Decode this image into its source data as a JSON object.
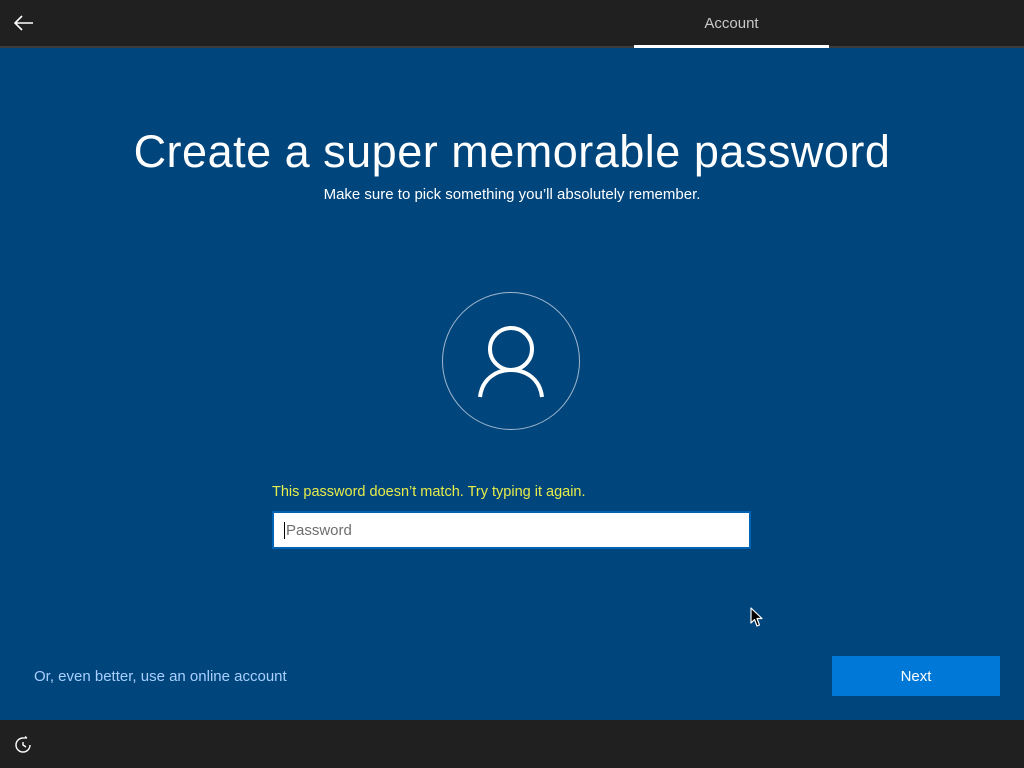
{
  "header": {
    "back_icon": "back-arrow-icon",
    "tab_label": "Account"
  },
  "main": {
    "title": "Create a super memorable password",
    "subtitle": "Make sure to pick something you’ll absolutely remember.",
    "avatar_icon": "user-icon",
    "error_message": "This password doesn’t match. Try typing it again.",
    "password_placeholder": "Password",
    "password_value": "",
    "online_account_link": "Or, even better, use an online account",
    "next_button": "Next"
  },
  "footer": {
    "accessibility_icon": "ease-of-access-icon"
  },
  "colors": {
    "background": "#00457c",
    "bar": "#202020",
    "error": "#e6ec4a",
    "accent": "#0078d7",
    "link": "#a8d0ff"
  }
}
